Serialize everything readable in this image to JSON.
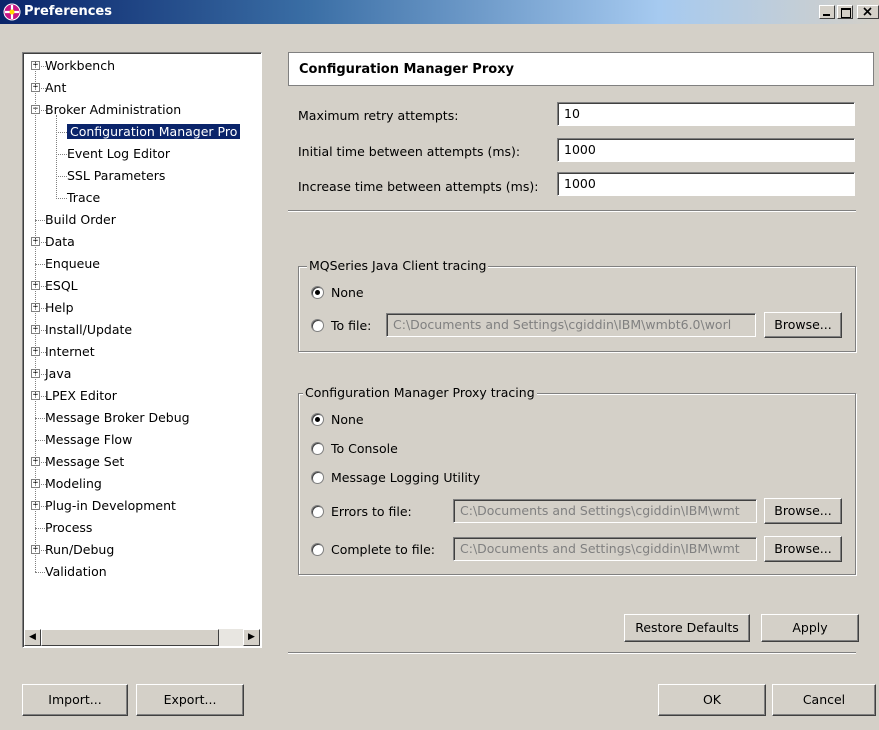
{
  "window": {
    "title": "Preferences"
  },
  "tree": {
    "items": [
      {
        "label": "Workbench",
        "level": 0,
        "expander": "+"
      },
      {
        "label": "Ant",
        "level": 0,
        "expander": "+"
      },
      {
        "label": "Broker Administration",
        "level": 0,
        "expander": "-"
      },
      {
        "label": "Configuration Manager Pro",
        "level": 1,
        "selected": true
      },
      {
        "label": "Event Log Editor",
        "level": 1
      },
      {
        "label": "SSL Parameters",
        "level": 1
      },
      {
        "label": "Trace",
        "level": 1
      },
      {
        "label": "Build Order",
        "level": 0
      },
      {
        "label": "Data",
        "level": 0,
        "expander": "+"
      },
      {
        "label": "Enqueue",
        "level": 0
      },
      {
        "label": "ESQL",
        "level": 0,
        "expander": "+"
      },
      {
        "label": "Help",
        "level": 0,
        "expander": "+"
      },
      {
        "label": "Install/Update",
        "level": 0,
        "expander": "+"
      },
      {
        "label": "Internet",
        "level": 0,
        "expander": "+"
      },
      {
        "label": "Java",
        "level": 0,
        "expander": "+"
      },
      {
        "label": "LPEX Editor",
        "level": 0,
        "expander": "+"
      },
      {
        "label": "Message Broker Debug",
        "level": 0
      },
      {
        "label": "Message Flow",
        "level": 0
      },
      {
        "label": "Message Set",
        "level": 0,
        "expander": "+"
      },
      {
        "label": "Modeling",
        "level": 0,
        "expander": "+"
      },
      {
        "label": "Plug-in Development",
        "level": 0,
        "expander": "+"
      },
      {
        "label": "Process",
        "level": 0
      },
      {
        "label": "Run/Debug",
        "level": 0,
        "expander": "+"
      },
      {
        "label": "Validation",
        "level": 0
      }
    ]
  },
  "page": {
    "title": "Configuration Manager Proxy",
    "fields": {
      "max_retry_label": "Maximum retry attempts:",
      "max_retry_value": "10",
      "initial_time_label": "Initial time between attempts (ms):",
      "initial_time_value": "1000",
      "increase_time_label": "Increase time between attempts (ms):",
      "increase_time_value": "1000"
    },
    "mq_group": {
      "title": "MQSeries Java Client tracing",
      "none_label": "None",
      "tofile_label": "To file:",
      "tofile_value": "C:\\Documents and Settings\\cgiddin\\IBM\\wmbt6.0\\worl",
      "browse_label": "Browse..."
    },
    "proxy_group": {
      "title": "Configuration Manager Proxy tracing",
      "none_label": "None",
      "console_label": "To Console",
      "logging_label": "Message Logging Utility",
      "errors_label": "Errors to file:",
      "errors_value": "C:\\Documents and Settings\\cgiddin\\IBM\\wmt",
      "complete_label": "Complete to file:",
      "complete_value": "C:\\Documents and Settings\\cgiddin\\IBM\\wmt",
      "browse_label": "Browse..."
    },
    "restore_defaults_label": "Restore Defaults",
    "apply_label": "Apply"
  },
  "footer": {
    "import_label": "Import...",
    "export_label": "Export...",
    "ok_label": "OK",
    "cancel_label": "Cancel"
  }
}
